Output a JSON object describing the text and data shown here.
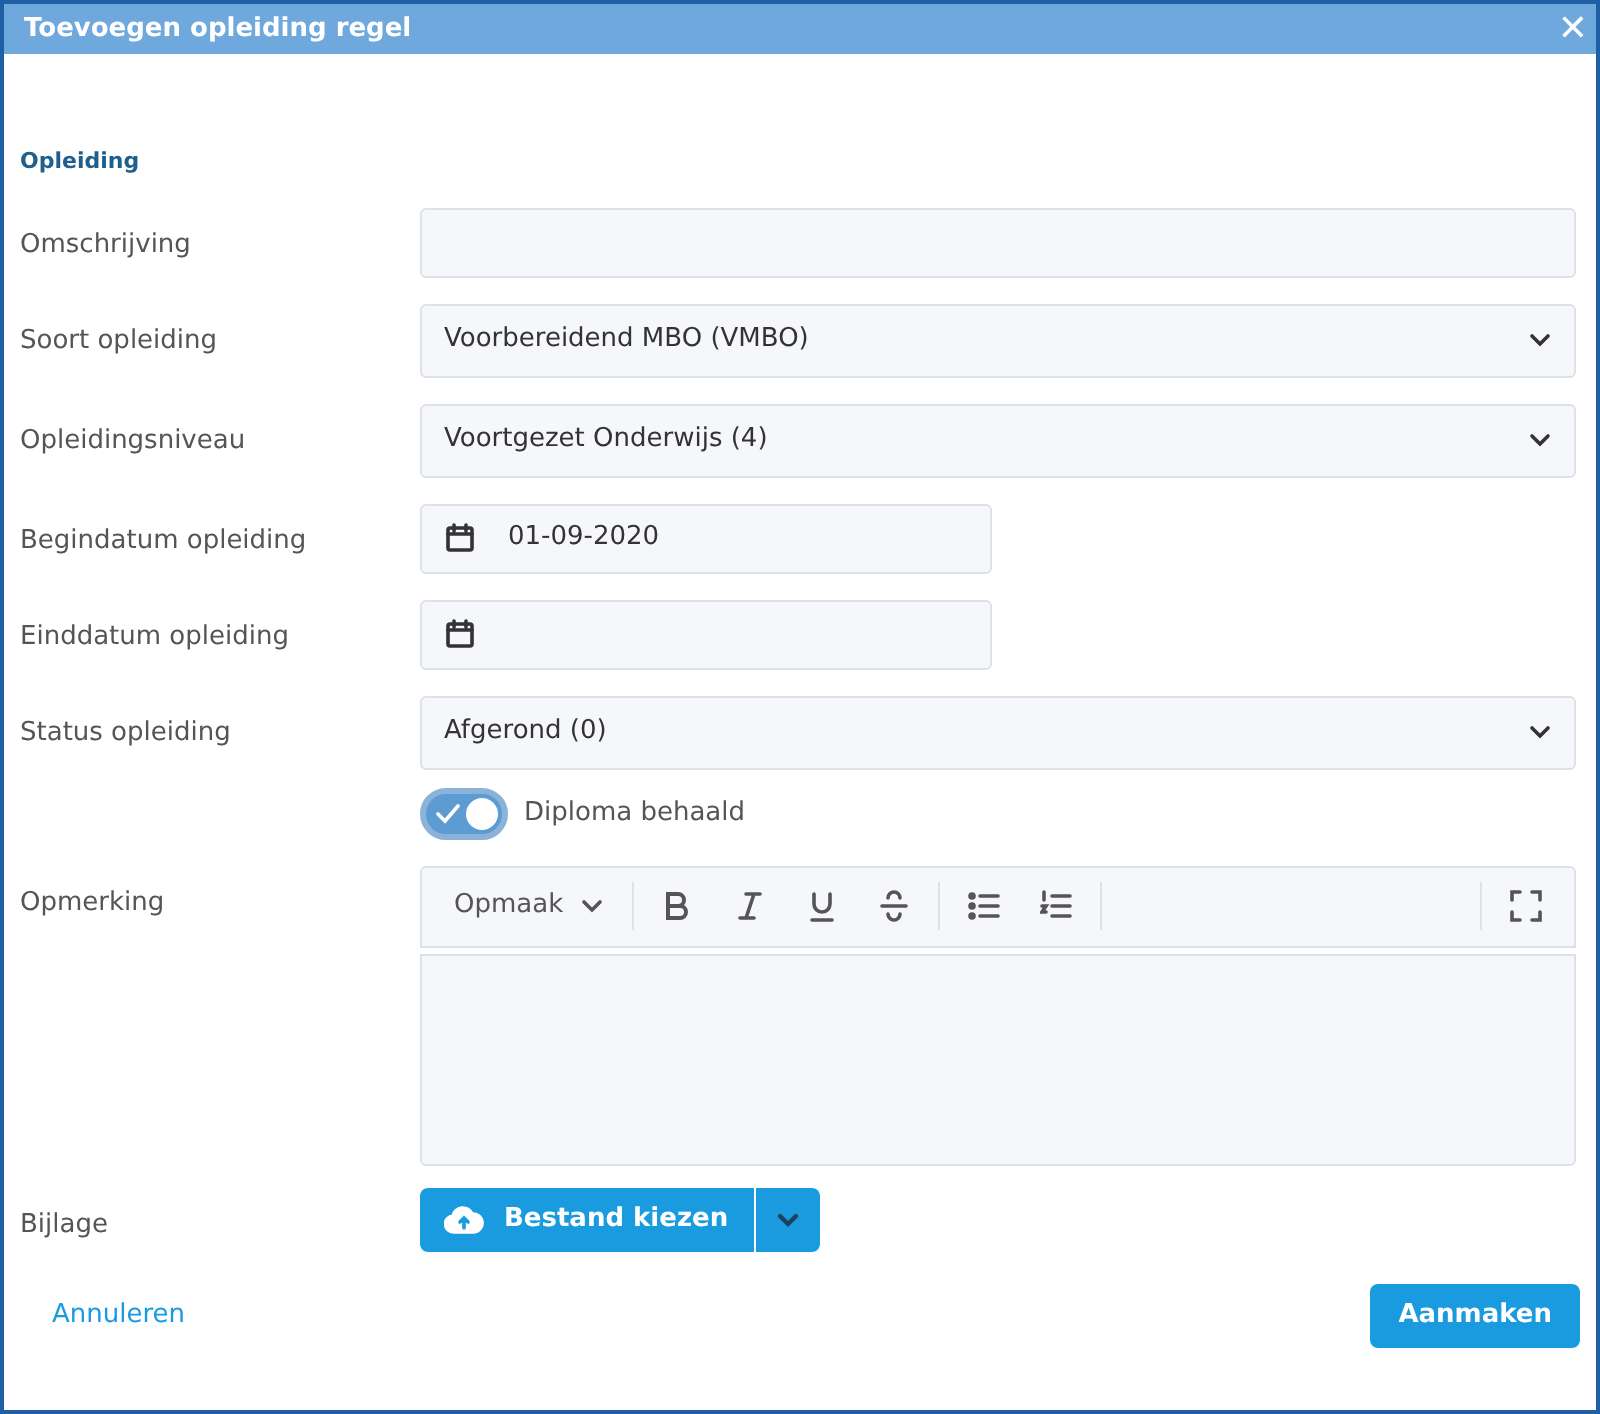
{
  "window": {
    "title": "Toevoegen opleiding regel",
    "close": "✕"
  },
  "section": "Opleiding",
  "rows": [
    {
      "kind": "text",
      "label": "Omschrijving",
      "value": ""
    },
    {
      "kind": "select",
      "label": "Soort opleiding",
      "value": "Voorbereidend MBO (VMBO)"
    },
    {
      "kind": "select",
      "label": "Opleidingsniveau",
      "value": "Voortgezet Onderwijs (4)"
    },
    {
      "kind": "date",
      "label": "Begindatum opleiding",
      "value": "01-09-2020"
    },
    {
      "kind": "date",
      "label": "Einddatum opleiding",
      "value": ""
    },
    {
      "kind": "select",
      "label": "Status opleiding",
      "value": "Afgerond (0)"
    },
    {
      "kind": "toggle",
      "label": "",
      "text": "Diploma behaald",
      "on": true
    },
    {
      "kind": "editor",
      "label": "Opmerking",
      "format": "Opmaak"
    },
    {
      "kind": "file",
      "label": "Bijlage",
      "button": "Bestand kiezen"
    }
  ],
  "cancel": "Annuleren",
  "submit": "Aanmaken"
}
